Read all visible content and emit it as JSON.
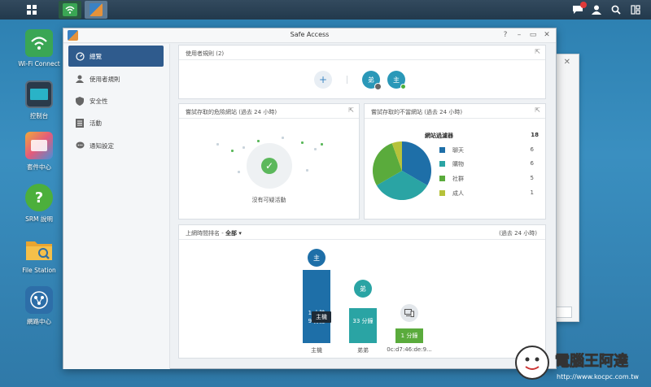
{
  "window": {
    "title": "Safe Access"
  },
  "desktop_icons": [
    {
      "label": "Wi-Fi Connect",
      "icon": "wifi-icon"
    },
    {
      "label": "控制台",
      "icon": "control-panel-icon"
    },
    {
      "label": "套件中心",
      "icon": "package-center-icon"
    },
    {
      "label": "SRM 說明",
      "icon": "help-icon"
    },
    {
      "label": "File Station",
      "icon": "folder-icon"
    },
    {
      "label": "網路中心",
      "icon": "network-center-icon"
    }
  ],
  "sidebar": {
    "items": [
      {
        "label": "總覽",
        "icon": "dashboard-icon",
        "active": true
      },
      {
        "label": "使用者規則",
        "icon": "user-icon",
        "active": false
      },
      {
        "label": "安全性",
        "icon": "shield-icon",
        "active": false
      },
      {
        "label": "活動",
        "icon": "list-icon",
        "active": false
      },
      {
        "label": "通知設定",
        "icon": "chat-icon",
        "active": false
      }
    ]
  },
  "profiles_panel": {
    "title": "使用者規則 (2)",
    "add_label": "+",
    "profiles": [
      {
        "label": "弟",
        "status": "blocked"
      },
      {
        "label": "主",
        "status": "online"
      }
    ]
  },
  "dangerous_panel": {
    "title": "嘗試存取的危險網站 (過去 24 小時)",
    "status": "沒有可疑活動"
  },
  "inappropriate_panel": {
    "title": "嘗試存取的不當網站 (過去 24 小時)",
    "filter_label": "網站過濾器",
    "filter_total": "18",
    "categories": [
      {
        "name": "聊天",
        "value": "6",
        "color": "#1e6fa8"
      },
      {
        "name": "購物",
        "value": "6",
        "color": "#2aa4a4"
      },
      {
        "name": "社群",
        "value": "5",
        "color": "#5aab3c"
      },
      {
        "name": "成人",
        "value": "1",
        "color": "#b6c23a"
      }
    ]
  },
  "chart_data": {
    "type": "pie",
    "title": "",
    "categories": [
      "聊天",
      "購物",
      "社群",
      "成人"
    ],
    "values": [
      6,
      6,
      5,
      1
    ],
    "colors": [
      "#1e6fa8",
      "#2aa4a4",
      "#5aab3c",
      "#b6c23a"
    ]
  },
  "time_panel": {
    "title_prefix": "上網時間排名 - ",
    "filter": "全部",
    "period": "(過去 24 小時)",
    "tooltip": "主機",
    "bars": [
      {
        "avatar": "主",
        "label_line1": "1 小時",
        "label_line2": "9 分鐘",
        "name": "主機",
        "minutes": 69,
        "color": "#1e6fa8",
        "avatar_color": "#1e6fa8"
      },
      {
        "avatar": "弟",
        "label_line1": "",
        "label_line2": "33 分鐘",
        "name": "弟弟",
        "minutes": 33,
        "color": "#2aa4a4",
        "avatar_color": "#2aa4a4"
      },
      {
        "avatar": "device-icon",
        "label_line1": "",
        "label_line2": "1 分鐘",
        "name": "0c:d7:46:de:9...",
        "minutes": 1,
        "color": "#5aab3c",
        "avatar_color": "#e3e7eb"
      }
    ]
  }
}
